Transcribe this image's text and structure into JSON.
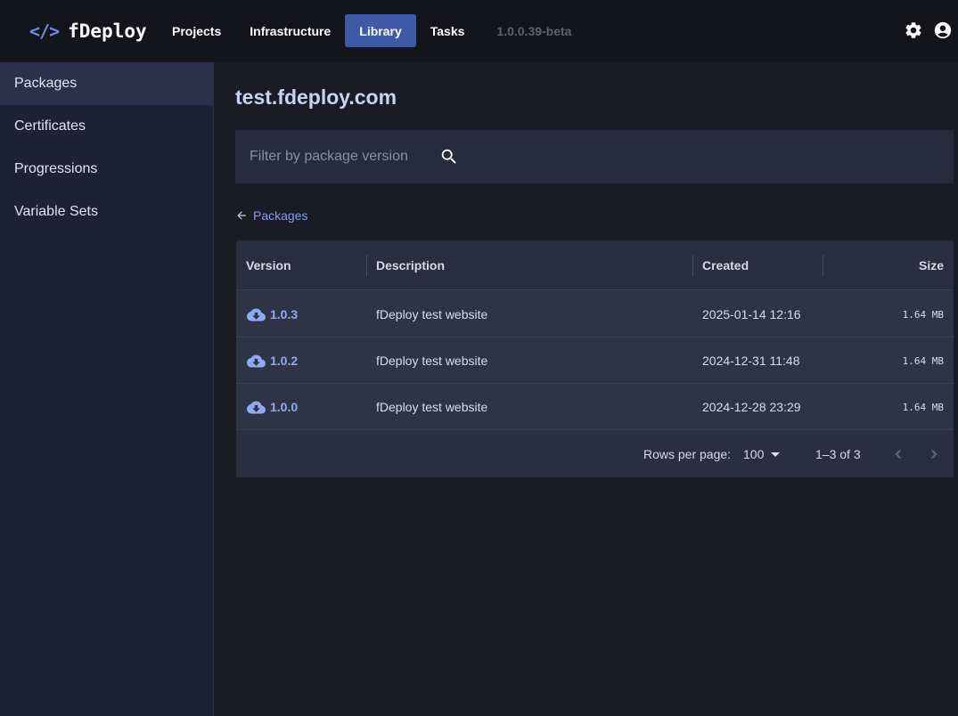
{
  "app": {
    "logo_glyph": "</>",
    "name": "fDeploy",
    "version": "1.0.0.39-beta"
  },
  "nav": {
    "items": [
      {
        "label": "Projects",
        "active": false
      },
      {
        "label": "Infrastructure",
        "active": false
      },
      {
        "label": "Library",
        "active": true
      },
      {
        "label": "Tasks",
        "active": false
      }
    ]
  },
  "top_icons": [
    "gear-icon",
    "account-circle-icon"
  ],
  "sidebar": {
    "items": [
      {
        "label": "Packages",
        "active": true
      },
      {
        "label": "Certificates",
        "active": false
      },
      {
        "label": "Progressions",
        "active": false
      },
      {
        "label": "Variable Sets",
        "active": false
      }
    ]
  },
  "main": {
    "title": "test.fdeploy.com",
    "filter": {
      "placeholder": "Filter by package version",
      "value": ""
    },
    "back_link": "Packages"
  },
  "table": {
    "headers": {
      "version": "Version",
      "description": "Description",
      "created": "Created",
      "size": "Size"
    },
    "rows": [
      {
        "version": "1.0.3",
        "description": "fDeploy test website",
        "created": "2025-01-14 12:16",
        "size": "1.64 MB"
      },
      {
        "version": "1.0.2",
        "description": "fDeploy test website",
        "created": "2024-12-31 11:48",
        "size": "1.64 MB"
      },
      {
        "version": "1.0.0",
        "description": "fDeploy test website",
        "created": "2024-12-28 23:29",
        "size": "1.64 MB"
      }
    ],
    "footer": {
      "rows_per_page_label": "Rows per page:",
      "rows_per_page_value": "100",
      "range": "1–3 of 3"
    }
  },
  "colors": {
    "accent": "#3f5aa6",
    "link": "#7fa0f0",
    "background": "#1b1b26",
    "sidebar": "#1e2234"
  }
}
